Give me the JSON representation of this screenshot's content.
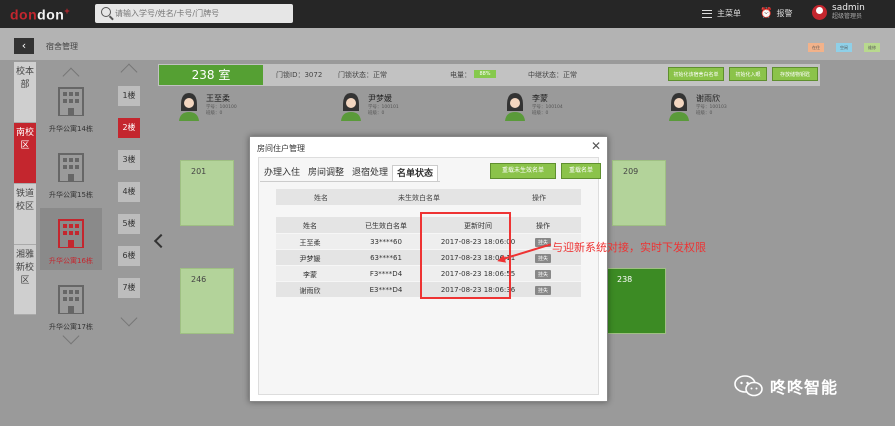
{
  "header": {
    "logo_a": "don",
    "logo_b": "don",
    "logo_plus": "+",
    "search_placeholder": "请输入学号/姓名/卡号/门牌号",
    "main_menu": "主菜单",
    "alarm": "报警",
    "user_name": "sadmin",
    "user_role": "超级管理员"
  },
  "breadcrumb": "宿舍管理",
  "legend": [
    "在住",
    "空闲",
    "维修"
  ],
  "campuses": [
    {
      "label": "校本部",
      "active": false
    },
    {
      "label": "南校区",
      "active": true
    },
    {
      "label": "铁道校区",
      "active": false
    },
    {
      "label": "湘雅新校区",
      "active": false
    }
  ],
  "buildings": [
    {
      "label": "升华公寓14栋",
      "active": false
    },
    {
      "label": "升华公寓15栋",
      "active": false
    },
    {
      "label": "升华公寓16栋",
      "active": true
    },
    {
      "label": "升华公寓17栋",
      "active": false
    }
  ],
  "floors": [
    "1楼",
    "2楼",
    "3楼",
    "4楼",
    "5楼",
    "6楼",
    "7楼"
  ],
  "active_floor": "2楼",
  "room": {
    "number": "238 室",
    "lock_id": "门锁ID：3072",
    "lock_status": "门锁状态：正常",
    "electricity_label": "电量：",
    "electricity_value": "88%",
    "relay_status": "中继状态：正常",
    "buttons": [
      "初始化该宿舍白名单",
      "初始化入眼",
      "存放储物钥匙"
    ]
  },
  "residents": [
    {
      "name": "王至柔",
      "meta1": "学号：100100",
      "meta2": "班级：0"
    },
    {
      "name": "尹梦媛",
      "meta1": "学号：100101",
      "meta2": "班级：0"
    },
    {
      "name": "李蒙",
      "meta1": "学号：100104",
      "meta2": "班级：0"
    },
    {
      "name": "谢雨欣",
      "meta1": "学号：100103",
      "meta2": "班级：0"
    }
  ],
  "tiles": [
    "201",
    "209",
    "246",
    "238"
  ],
  "dialog": {
    "title": "房间住户管理",
    "tabs": [
      "办理入住",
      "房间调整",
      "退宿处理",
      "名单状态"
    ],
    "active_tab": "名单状态",
    "btn_unissued": "重载未生效名单",
    "btn_reload": "重载名单",
    "list_head": {
      "name": "姓名",
      "pending": "未生效白名单",
      "op": "操作"
    },
    "table_head": {
      "name": "姓名",
      "issued": "已生效白名单",
      "time": "更新时间",
      "op": "操作"
    },
    "rows": [
      {
        "name": "王至柔",
        "card": "33****60",
        "time": "2017-08-23 18:06:00",
        "op": "挂失"
      },
      {
        "name": "尹梦媛",
        "card": "63****61",
        "time": "2017-08-23 18:06:11",
        "op": "挂失"
      },
      {
        "name": "李蒙",
        "card": "F3****D4",
        "time": "2017-08-23 18:06:55",
        "op": "挂失"
      },
      {
        "name": "谢雨欣",
        "card": "E3****D4",
        "time": "2017-08-23 18:06:36",
        "op": "挂失"
      }
    ]
  },
  "annotation": "与迎新系统对接，实时下发权限",
  "watermark": "咚咚智能",
  "colors": {
    "brand": "#c4262e",
    "green": "#8bc34a",
    "highlight": "#e33333"
  }
}
